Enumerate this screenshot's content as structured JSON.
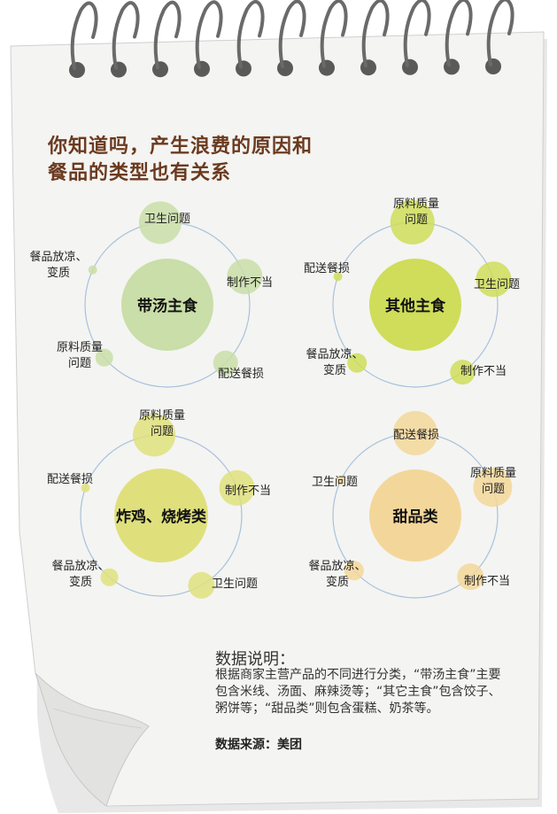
{
  "title": {
    "line1": "你知道吗，产生浪费的原因和",
    "line2": "餐品的类型也有关系"
  },
  "colors": {
    "title": "#6b3a1f",
    "soup_main": "#c9dea8",
    "other_main": "#cfdd5a",
    "fried": "#dfe07c",
    "dessert": "#f3d79a",
    "orbit": "#a9c1dc"
  },
  "diagrams": [
    {
      "center": "带汤主食",
      "nodes": [
        {
          "line1": "卫生问题",
          "line2": ""
        },
        {
          "line1": "制作不当",
          "line2": ""
        },
        {
          "line1": "配送餐损",
          "line2": ""
        },
        {
          "line1": "原料质量",
          "line2": "问题"
        },
        {
          "line1": "餐品放凉、",
          "line2": "变质"
        }
      ]
    },
    {
      "center": "其他主食",
      "nodes": [
        {
          "line1": "原料质量",
          "line2": "问题"
        },
        {
          "line1": "卫生问题",
          "line2": ""
        },
        {
          "line1": "制作不当",
          "line2": ""
        },
        {
          "line1": "餐品放凉、",
          "line2": "变质"
        },
        {
          "line1": "配送餐损",
          "line2": ""
        }
      ]
    },
    {
      "center": "炸鸡、烧烤类",
      "nodes": [
        {
          "line1": "原料质量",
          "line2": "问题"
        },
        {
          "line1": "制作不当",
          "line2": ""
        },
        {
          "line1": "卫生问题",
          "line2": ""
        },
        {
          "line1": "餐品放凉、",
          "line2": "变质"
        },
        {
          "line1": "配送餐损",
          "line2": ""
        }
      ]
    },
    {
      "center": "甜品类",
      "nodes": [
        {
          "line1": "配送餐损",
          "line2": ""
        },
        {
          "line1": "原料质量",
          "line2": "问题"
        },
        {
          "line1": "制作不当",
          "line2": ""
        },
        {
          "line1": "餐品放凉、",
          "line2": "变质"
        },
        {
          "line1": "卫生问题",
          "line2": ""
        }
      ]
    }
  ],
  "notes": {
    "heading": "数据说明：",
    "text": "根据商家主营产品的不同进行分类，“带汤主食”主要包含米线、汤面、麻辣烫等；“其它主食”包含饺子、粥饼等；“甜品类”则包含蛋糕、奶茶等。",
    "source": "数据来源：美团"
  }
}
